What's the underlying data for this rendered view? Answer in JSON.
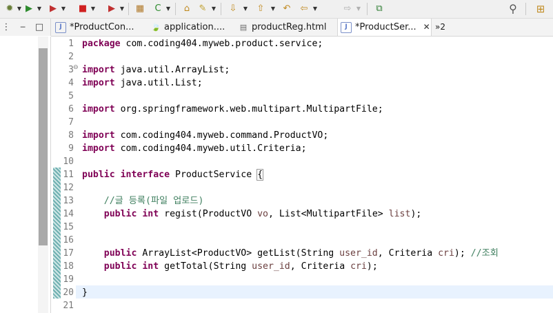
{
  "toolbar": {
    "items": [
      {
        "name": "debug-icon",
        "glyph": "✹",
        "color": "#6a7f3a"
      },
      {
        "name": "run-icon",
        "glyph": "▶",
        "color": "#2e8b2e"
      },
      {
        "name": "run-server-icon",
        "glyph": "▶",
        "color": "#c03030"
      },
      {
        "name": "stop-icon",
        "glyph": "■",
        "color": "#d02020"
      },
      {
        "name": "external-tools-icon",
        "glyph": "▶",
        "color": "#c03030"
      },
      {
        "name": "new-package-icon",
        "glyph": "▦",
        "color": "#b07828"
      },
      {
        "name": "new-class-icon",
        "glyph": "C",
        "color": "#2e8b2e"
      },
      {
        "name": "open-type-icon",
        "glyph": "⌂",
        "color": "#c08a20"
      },
      {
        "name": "open-task-icon",
        "glyph": "✎",
        "color": "#c0a030"
      },
      {
        "name": "next-annotation-icon",
        "glyph": "⇩",
        "color": "#c08a20"
      },
      {
        "name": "previous-annotation-icon",
        "glyph": "⇧",
        "color": "#c08a20"
      },
      {
        "name": "last-edit-icon",
        "glyph": "↶",
        "color": "#c08a20"
      },
      {
        "name": "back-icon",
        "glyph": "⇦",
        "color": "#c08a20"
      },
      {
        "name": "forward-icon",
        "glyph": "⇨",
        "color": "#b0b0b0"
      },
      {
        "name": "pin-editor-icon",
        "glyph": "⧉",
        "color": "#2e7d32"
      }
    ],
    "search_icon": "⚲",
    "perspective_icon": "⊞"
  },
  "left_panel": {
    "menu_icon": "⋮",
    "minimize": "─",
    "maximize": "□"
  },
  "tabs": [
    {
      "label": "*ProductCon...",
      "icon": "J",
      "active": false
    },
    {
      "label": "application....",
      "icon": "🍃",
      "active": false
    },
    {
      "label": "productReg.html",
      "icon": "▤",
      "active": false
    },
    {
      "label": "*ProductSer...",
      "icon": "J",
      "active": true,
      "close": "✕"
    }
  ],
  "overflow_tabs": "»2",
  "editor": {
    "lines": [
      {
        "n": "1",
        "fold": ""
      },
      {
        "n": "2",
        "fold": ""
      },
      {
        "n": "3",
        "fold": "⊖"
      },
      {
        "n": "4",
        "fold": ""
      },
      {
        "n": "5",
        "fold": ""
      },
      {
        "n": "6",
        "fold": ""
      },
      {
        "n": "7",
        "fold": ""
      },
      {
        "n": "8",
        "fold": ""
      },
      {
        "n": "9",
        "fold": ""
      },
      {
        "n": "10",
        "fold": ""
      },
      {
        "n": "11",
        "fold": ""
      },
      {
        "n": "12",
        "fold": ""
      },
      {
        "n": "13",
        "fold": ""
      },
      {
        "n": "14",
        "fold": ""
      },
      {
        "n": "15",
        "fold": ""
      },
      {
        "n": "16",
        "fold": ""
      },
      {
        "n": "17",
        "fold": ""
      },
      {
        "n": "18",
        "fold": ""
      },
      {
        "n": "19",
        "fold": ""
      },
      {
        "n": "20",
        "fold": ""
      },
      {
        "n": "21",
        "fold": ""
      }
    ],
    "code": {
      "l1_kw": "package",
      "l1_rest": " com.coding404.myweb.product.service;",
      "l3_kw": "import",
      "l3_rest": " java.util.ArrayList;",
      "l4_kw": "import",
      "l4_rest": " java.util.List;",
      "l6_kw": "import",
      "l6_rest": " org.springframework.web.multipart.MultipartFile;",
      "l8_kw": "import",
      "l8_rest": " com.coding404.myweb.command.ProductVO;",
      "l9_kw": "import",
      "l9_rest": " com.coding404.myweb.util.Criteria;",
      "l11_kw1": "public",
      "l11_kw2": "interface",
      "l11_rest": " ProductService ",
      "l11_brace": "{",
      "l13_comment": "//글 등록(파일 업로드)",
      "l14_kw1": "public",
      "l14_kw2": "int",
      "l14_a": " regist(ProductVO ",
      "l14_v1": "vo",
      "l14_b": ", List<MultipartFile> ",
      "l14_v2": "list",
      "l14_c": ");",
      "l17_kw": "public",
      "l17_a": " ArrayList<ProductVO> getList(String ",
      "l17_v1": "user_id",
      "l17_b": ", Criteria ",
      "l17_v2": "cri",
      "l17_c": "); ",
      "l17_comment": "//조회",
      "l18_kw1": "public",
      "l18_kw2": "int",
      "l18_a": " getTotal(String ",
      "l18_v1": "user_id",
      "l18_b": ", Criteria ",
      "l18_v2": "cri",
      "l18_c": ");",
      "l20_brace": "}"
    }
  }
}
